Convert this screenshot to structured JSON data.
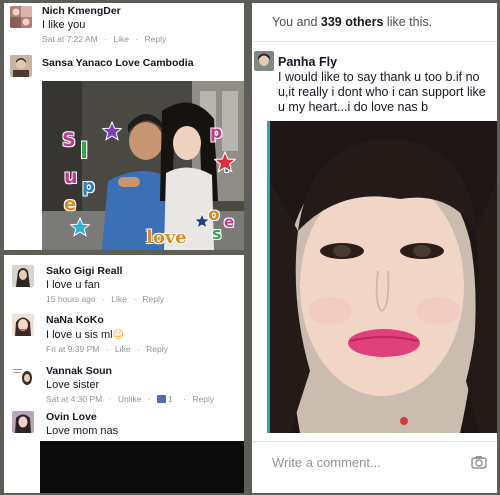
{
  "comments_top": [
    {
      "name": "Nich KmengDer",
      "text": "I like you",
      "time": "Sat at 7:22 AM",
      "like": "Like",
      "reply": "Reply"
    },
    {
      "name": "Sansa Yanaco Love Cambodia"
    }
  ],
  "collage": {
    "letters_left": [
      "S",
      "I",
      "u",
      "p",
      "e"
    ],
    "letters_right": [
      "p",
      "r",
      "i",
      "o",
      "s",
      "e"
    ],
    "love_word": "love"
  },
  "comments_bottom": [
    {
      "name": "Sako Gigi Reall",
      "text": "I love u fan",
      "time": "15 hours ago",
      "like": "Like",
      "reply": "Reply"
    },
    {
      "name": "NaNa KoKo",
      "text": "I love u sis ml",
      "emoji": "☺",
      "time": "Fri at 9:39 PM",
      "like": "Like",
      "reply": "Reply"
    },
    {
      "name": "Vannak Soun",
      "text": "Love sister",
      "time": "Sat at 4:30 PM",
      "unlike": "Unlike",
      "like_count": "1",
      "reply": "Reply"
    },
    {
      "name": "Ovin Love",
      "text": "Love mom nas"
    }
  ],
  "right": {
    "likes_prefix": "You and ",
    "likes_bold": "339 others",
    "likes_suffix": " like this.",
    "commenter": "Panha Fly",
    "comment": "I would like to say thank u too b.if no u,it really i dont who i can support like u my heart...i do love nas b",
    "write_placeholder": "Write a comment..."
  },
  "colors": {
    "background": "#5f5d58",
    "link_blue": "#4c6fb2",
    "meta_gray": "#90949c",
    "lipstick": "#e0407a",
    "frame_teal": "#2aa7b5"
  }
}
